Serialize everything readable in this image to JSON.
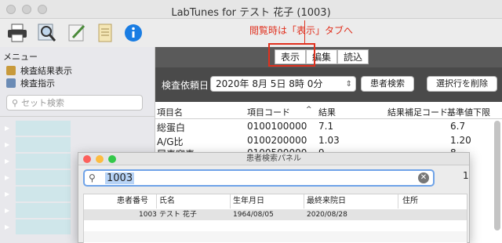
{
  "window": {
    "title": "LabTunes for テスト 花子 (1003)"
  },
  "toolbar": {
    "icons": [
      "printer-icon",
      "magnifier-icon",
      "edit-icon",
      "notes-icon",
      "info-icon"
    ],
    "annotation": "閲覧時は「表示」タブへ"
  },
  "sidebar": {
    "menu_label": "メニュー",
    "items": [
      {
        "label": "検査結果表示",
        "icon": "results-icon"
      },
      {
        "label": "検査指示",
        "icon": "order-icon"
      }
    ],
    "search_placeholder": "セット検索"
  },
  "tabs": [
    {
      "label": "表示",
      "active": true
    },
    {
      "label": "編集",
      "active": false
    },
    {
      "label": "読込",
      "active": false
    }
  ],
  "filter": {
    "date_label": "検査依頼日",
    "date_value": "2020年 8月 5日 8時 0分",
    "patient_search_button": "患者検索",
    "delete_selected_button": "選択行を削除"
  },
  "grid": {
    "columns": [
      "項目名",
      "項目コード",
      "結果",
      "結果補足コード",
      "基準値下限"
    ],
    "sort_indicator": "^",
    "rows": [
      [
        "総蛋白",
        "0100100000",
        "7.1",
        "",
        "6.7"
      ],
      [
        "A/G比",
        "0100200000",
        "1.03",
        "",
        "1.20"
      ],
      [
        "尿素窒素",
        "0100500000",
        "9",
        "",
        "8"
      ]
    ]
  },
  "patient_panel": {
    "title": "患者検索パネル",
    "search_value": "1003",
    "result_count": "1",
    "columns": [
      "患者番号",
      "氏名",
      "生年月日",
      "最終来院日",
      "住所"
    ],
    "rows": [
      [
        "1003",
        "テスト 花子",
        "1964/08/05",
        "2020/08/28",
        ""
      ]
    ]
  },
  "colors": {
    "annotation_red": "#e0301e",
    "search_focus": "#6fa3e8",
    "pane_dark": "#4a4a4a"
  }
}
